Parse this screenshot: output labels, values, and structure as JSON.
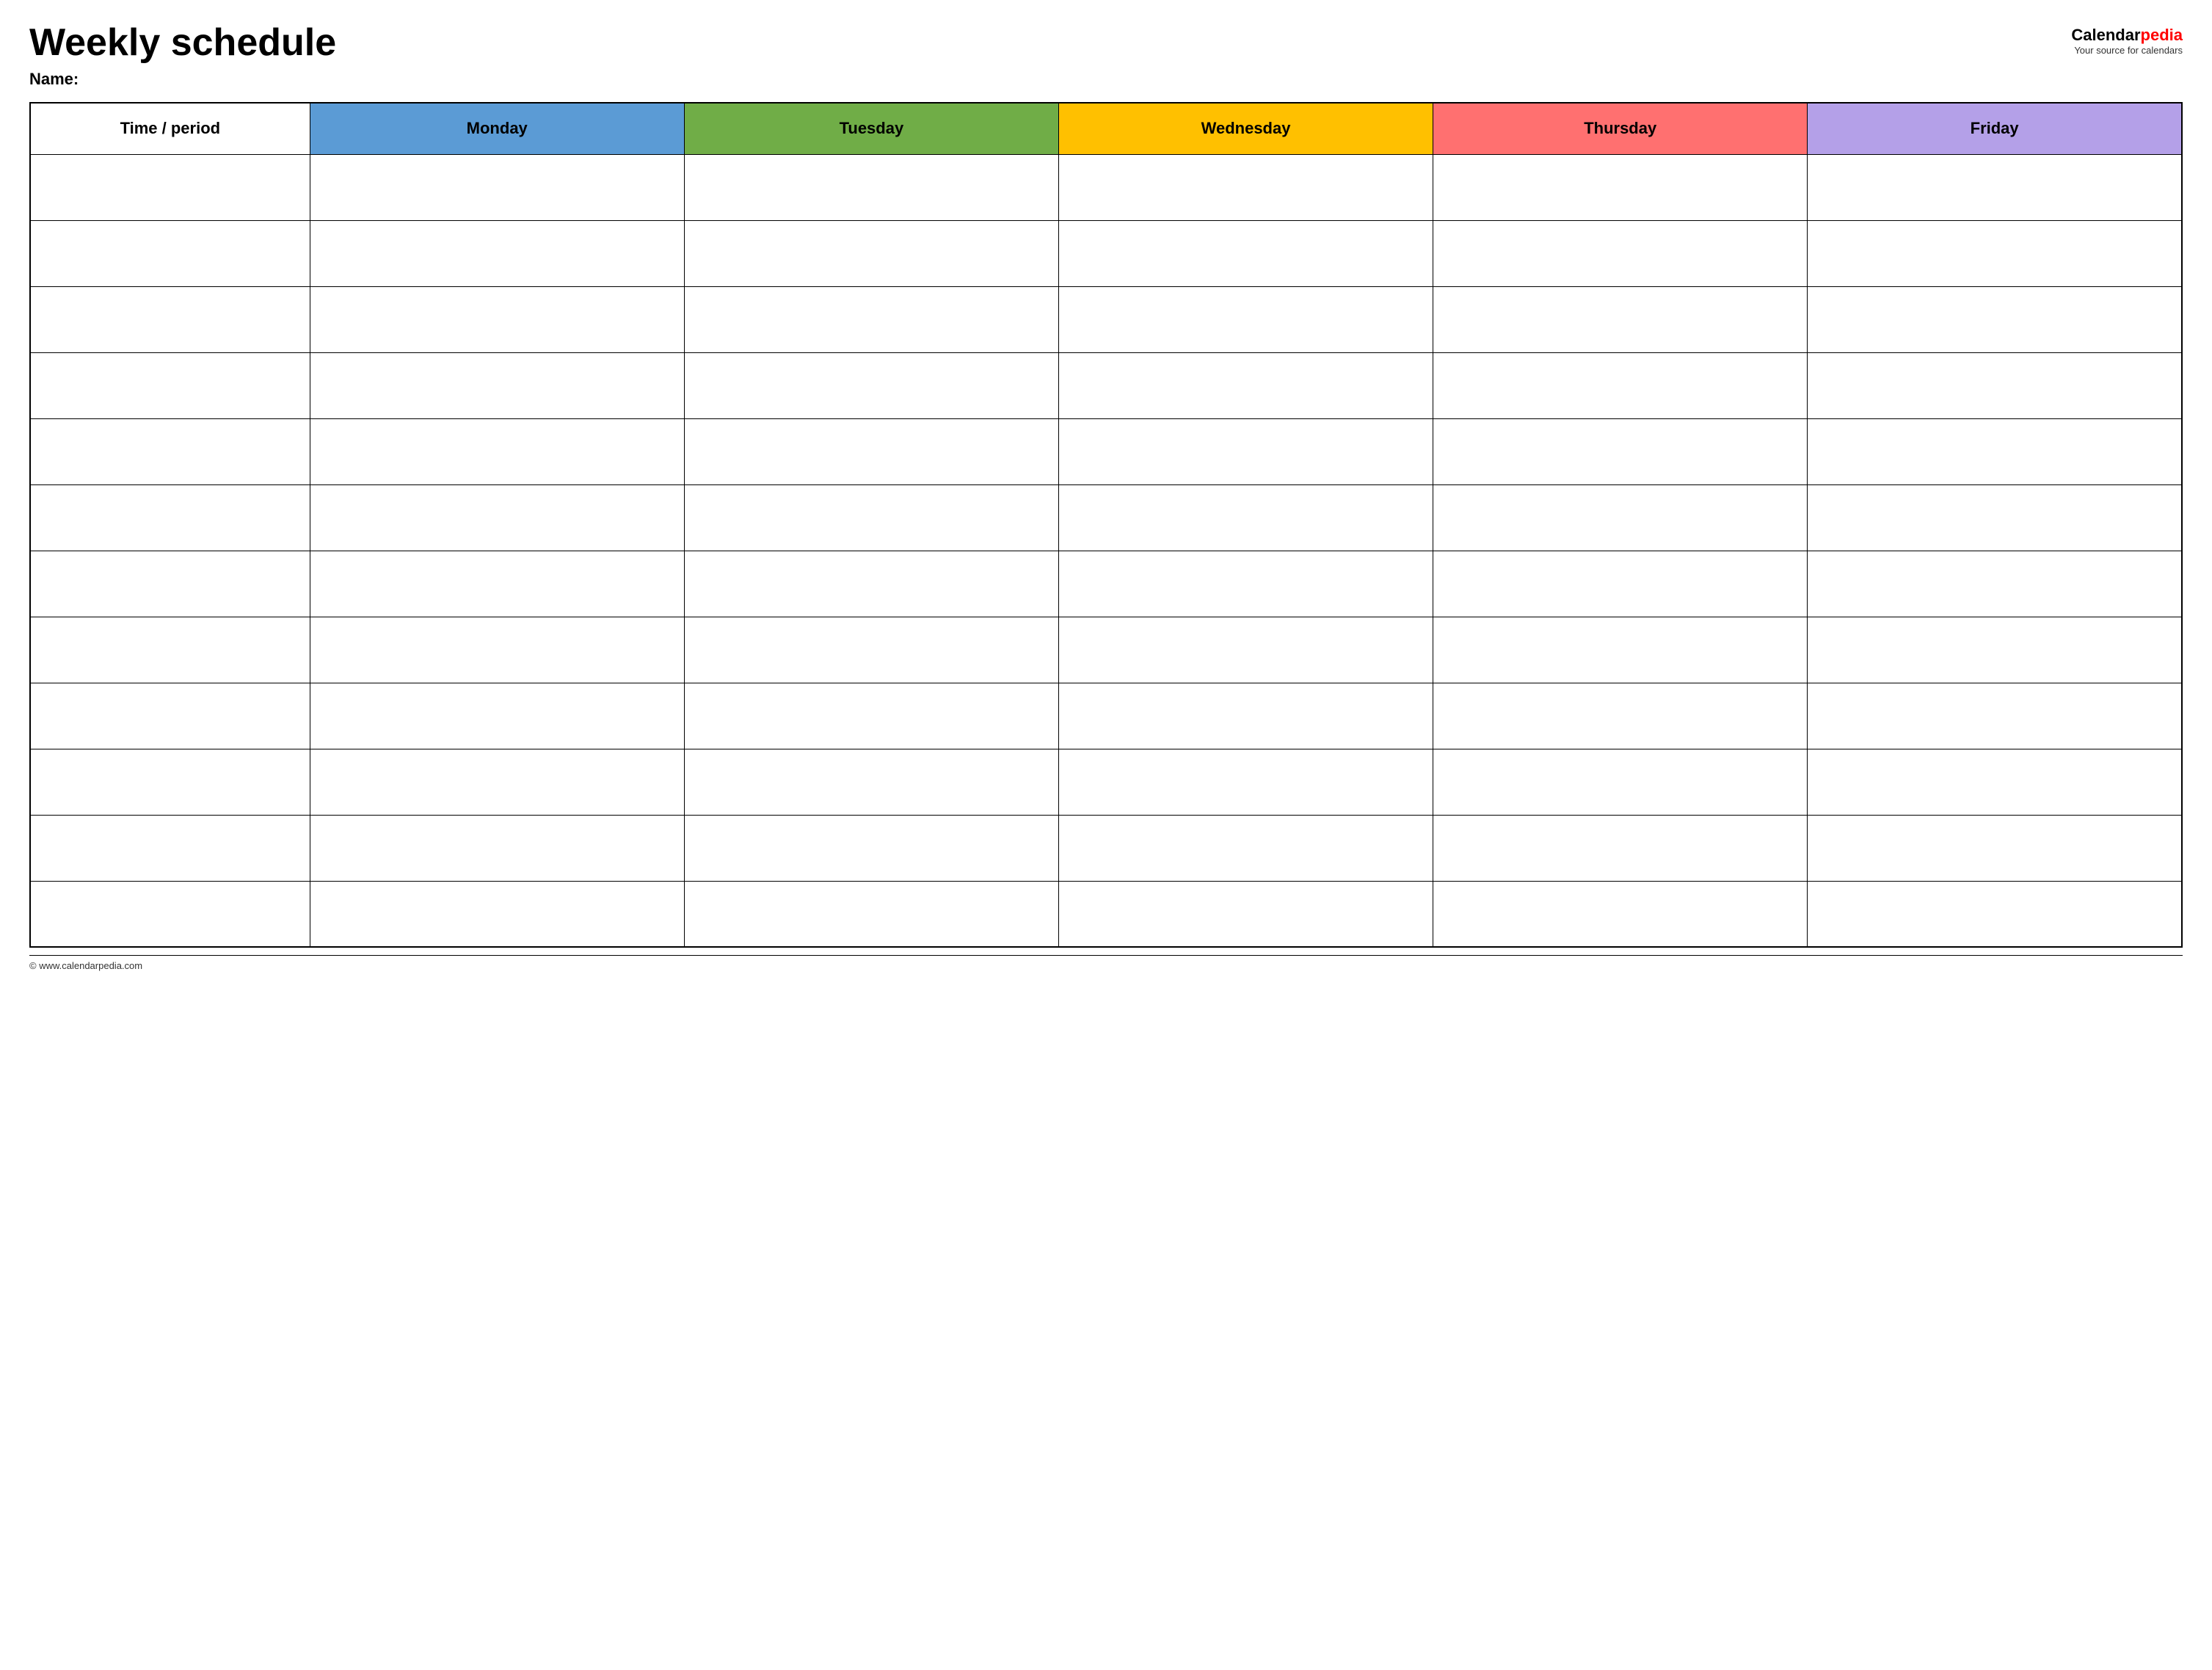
{
  "header": {
    "title": "Weekly schedule",
    "name_label": "Name:",
    "logo_calendar": "Calendar",
    "logo_pedia": "pedia",
    "logo_tagline": "Your source for calendars"
  },
  "table": {
    "columns": [
      {
        "key": "time",
        "label": "Time / period",
        "color": "white"
      },
      {
        "key": "monday",
        "label": "Monday",
        "color": "#5b9bd5"
      },
      {
        "key": "tuesday",
        "label": "Tuesday",
        "color": "#70ad47"
      },
      {
        "key": "wednesday",
        "label": "Wednesday",
        "color": "#ffc000"
      },
      {
        "key": "thursday",
        "label": "Thursday",
        "color": "#ff7070"
      },
      {
        "key": "friday",
        "label": "Friday",
        "color": "#b4a0e8"
      }
    ],
    "row_count": 12
  },
  "footer": {
    "url": "© www.calendarpedia.com"
  }
}
